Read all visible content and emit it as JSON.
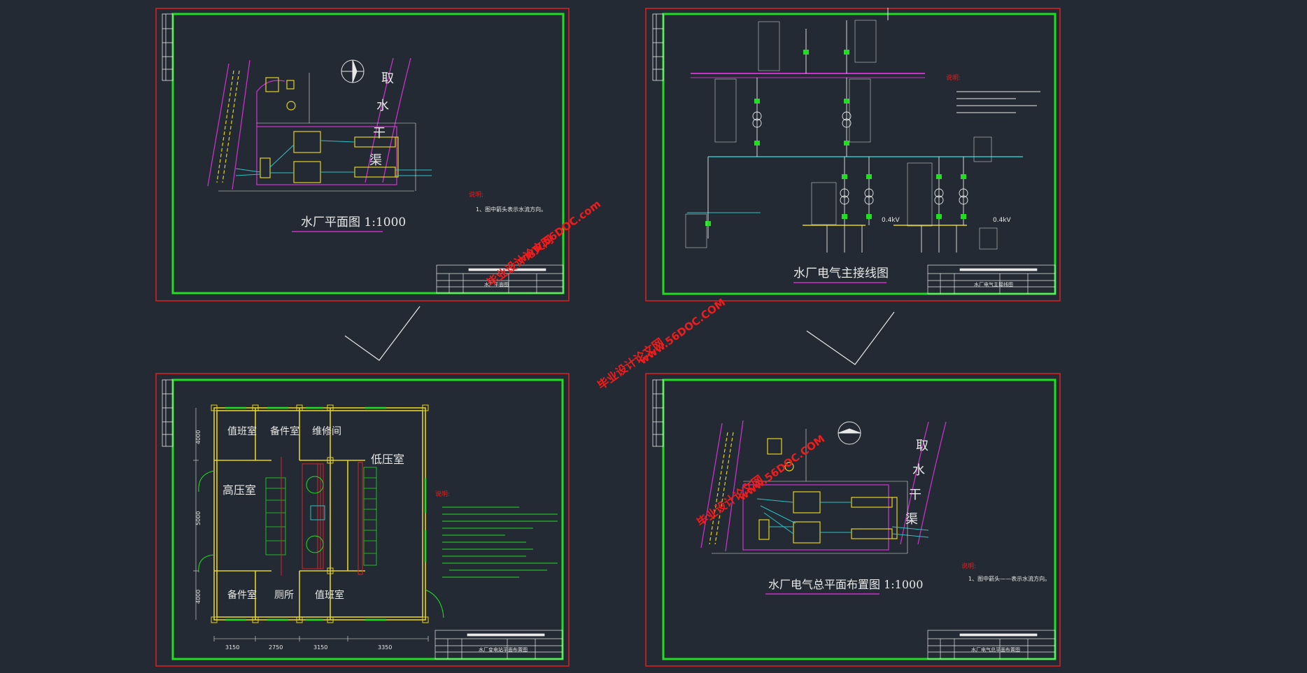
{
  "sheets": {
    "plant_plan": {
      "title": "水厂平面图 1:1000",
      "canal_name": "取水干渠",
      "canal_chars": [
        "取",
        "水",
        "干",
        "渠"
      ],
      "notes_heading": "说明:",
      "notes": [
        "1、图中箭头表示水流方向。"
      ],
      "title_block_name": "水厂平面图"
    },
    "main_wiring": {
      "title": "水厂电气主接线图",
      "notes_heading": "说明:",
      "voltage_labels": [
        "0.4kV",
        "0.4kV"
      ],
      "title_block_name": "水厂电气主接线图"
    },
    "substation_plan": {
      "rooms": [
        "值班室",
        "备件室",
        "维修间",
        "低压室",
        "高压室",
        "备件室",
        "厕所",
        "值班室"
      ],
      "notes_heading": "说明:",
      "dims_bottom": [
        "3150",
        "2750",
        "3150",
        "3350"
      ],
      "dims_left": [
        "4000",
        "5000",
        "4000"
      ],
      "title_block_name": "水厂变电站平面布置图"
    },
    "electrical_layout": {
      "title": "水厂电气总平面布置图 1:1000",
      "canal_chars": [
        "取",
        "水",
        "干",
        "渠"
      ],
      "notes_heading": "说明:",
      "notes": [
        "1、图中箭头——表示水流方向。"
      ],
      "title_block_name": "水厂电气总平面布置图"
    }
  },
  "watermarks": [
    {
      "site": "毕业设计论文网",
      "url": "www.56DOC.com"
    },
    {
      "site": "毕业设计论文网",
      "url": "www.56DOC.COM"
    },
    {
      "site": "毕业设计论文网",
      "url": "www.56DOC.COM"
    }
  ],
  "colors": {
    "background": "#232a33",
    "sheet_border": "#e02020",
    "inner_frame": "#22dd22",
    "cad_white": "#e8e8e8",
    "cad_magenta": "#c832c8",
    "cad_yellow": "#e6d21e",
    "cad_cyan": "#2bc3c3",
    "cad_green": "#22dd22",
    "cad_red": "#e02020"
  }
}
